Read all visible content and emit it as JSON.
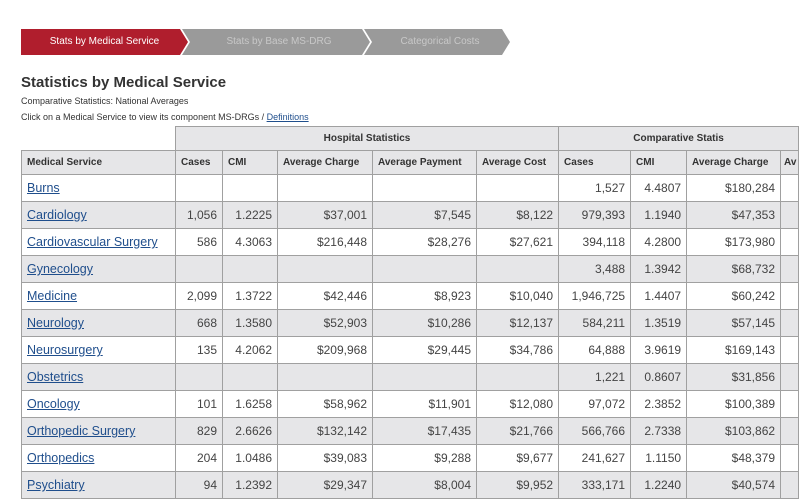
{
  "tabs": [
    {
      "label": "Stats by Medical Service",
      "active": true
    },
    {
      "label": "Stats by Base MS-DRG",
      "active": false
    },
    {
      "label": "Categorical Costs",
      "active": false
    }
  ],
  "title": "Statistics by Medical Service",
  "subtitle": "Comparative Statistics: National Averages",
  "instruction": "Click on a Medical Service to view its component MS-DRGs / ",
  "definitions_link": "Definitions",
  "table": {
    "groups": {
      "hospital": "Hospital Statistics",
      "comparative": "Comparative Statis"
    },
    "headers": [
      "Medical Service",
      "Cases",
      "CMI",
      "Average Charge",
      "Average Payment",
      "Average Cost",
      "Cases",
      "CMI",
      "Average Charge",
      "Av"
    ],
    "rows": [
      [
        "Burns",
        "",
        "",
        "",
        "",
        "",
        "1,527",
        "4.4807",
        "$180,284",
        ""
      ],
      [
        "Cardiology",
        "1,056",
        "1.2225",
        "$37,001",
        "$7,545",
        "$8,122",
        "979,393",
        "1.1940",
        "$47,353",
        ""
      ],
      [
        "Cardiovascular Surgery",
        "586",
        "4.3063",
        "$216,448",
        "$28,276",
        "$27,621",
        "394,118",
        "4.2800",
        "$173,980",
        ""
      ],
      [
        "Gynecology",
        "",
        "",
        "",
        "",
        "",
        "3,488",
        "1.3942",
        "$68,732",
        ""
      ],
      [
        "Medicine",
        "2,099",
        "1.3722",
        "$42,446",
        "$8,923",
        "$10,040",
        "1,946,725",
        "1.4407",
        "$60,242",
        ""
      ],
      [
        "Neurology",
        "668",
        "1.3580",
        "$52,903",
        "$10,286",
        "$12,137",
        "584,211",
        "1.3519",
        "$57,145",
        ""
      ],
      [
        "Neurosurgery",
        "135",
        "4.2062",
        "$209,968",
        "$29,445",
        "$34,786",
        "64,888",
        "3.9619",
        "$169,143",
        ""
      ],
      [
        "Obstetrics",
        "",
        "",
        "",
        "",
        "",
        "1,221",
        "0.8607",
        "$31,856",
        ""
      ],
      [
        "Oncology",
        "101",
        "1.6258",
        "$58,962",
        "$11,901",
        "$12,080",
        "97,072",
        "2.3852",
        "$100,389",
        ""
      ],
      [
        "Orthopedic Surgery",
        "829",
        "2.6626",
        "$132,142",
        "$17,435",
        "$21,766",
        "566,766",
        "2.7338",
        "$103,862",
        ""
      ],
      [
        "Orthopedics",
        "204",
        "1.0486",
        "$39,083",
        "$9,288",
        "$9,677",
        "241,627",
        "1.1150",
        "$48,379",
        ""
      ],
      [
        "Psychiatry",
        "94",
        "1.2392",
        "$29,347",
        "$8,004",
        "$9,952",
        "333,171",
        "1.2240",
        "$40,574",
        ""
      ]
    ]
  }
}
